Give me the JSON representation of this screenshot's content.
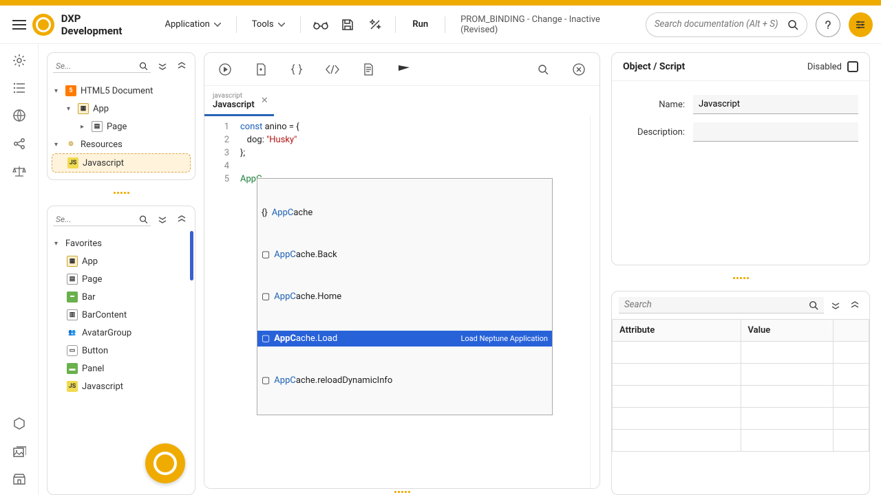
{
  "header": {
    "brand": "DXP Development",
    "menu": {
      "application": "Application",
      "tools": "Tools"
    },
    "run": "Run",
    "breadcrumb": "PROM_BINDING - Change - Inactive (Revised)",
    "search_placeholder": "Search documentation (Alt + S)"
  },
  "left_panel_top": {
    "search_placeholder": "Se...",
    "tree": {
      "root": "HTML5 Document",
      "app": "App",
      "page": "Page",
      "resources": "Resources",
      "javascript": "Javascript"
    }
  },
  "left_panel_bottom": {
    "search_placeholder": "Se...",
    "favorites_label": "Favorites",
    "items": [
      "App",
      "Page",
      "Bar",
      "BarContent",
      "AvatarGroup",
      "Button",
      "Panel",
      "Javascript"
    ]
  },
  "editor": {
    "tab_sub": "javascript",
    "tab_title": "Javascript",
    "lines": {
      "1": {
        "kw": "const",
        "ident": " anino = {"
      },
      "2": {
        "prefix": "   dog: ",
        "str": "\"Husky\""
      },
      "3": "};",
      "4": "",
      "5": "AppC"
    },
    "autocomplete": {
      "prefix": "AppC",
      "items": [
        {
          "suffix": "ache"
        },
        {
          "suffix": "ache.Back"
        },
        {
          "suffix": "ache.Home"
        },
        {
          "suffix": "ache.Load",
          "hint": "Load Neptune Application",
          "selected": true
        },
        {
          "suffix": "ache.reloadDynamicInfo"
        }
      ]
    }
  },
  "props": {
    "title": "Object / Script",
    "disabled": "Disabled",
    "name_label": "Name:",
    "name_value": "Javascript",
    "desc_label": "Description:",
    "desc_value": ""
  },
  "attr_panel": {
    "search_placeholder": "Search",
    "col_attr": "Attribute",
    "col_val": "Value"
  }
}
